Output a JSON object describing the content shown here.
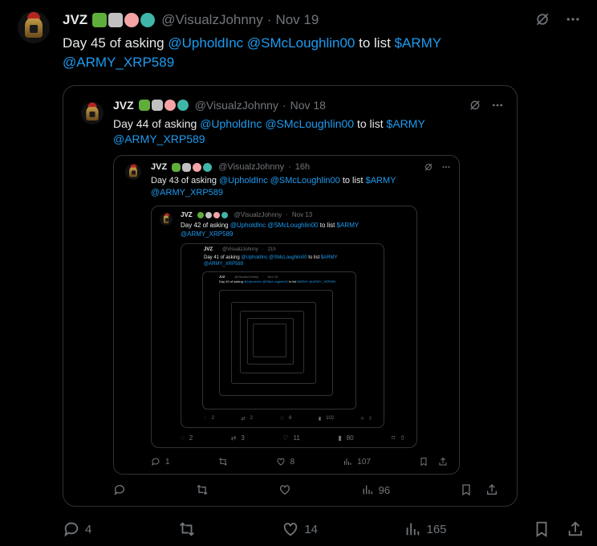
{
  "tweet": {
    "name": "JVZ",
    "handle": "@VisualzJohnny",
    "separator": "·",
    "date": "Nov 19",
    "text_prefix": "Day 45 of asking",
    "mention1": "@UpholdInc",
    "mention2": "@SMcLoughlin00",
    "text_mid": "to list",
    "cashtag": "$ARMY",
    "mention3": "@ARMY_XRP589",
    "stats": {
      "replies": "4",
      "likes": "14",
      "views": "165"
    }
  },
  "quote1": {
    "name": "JVZ",
    "handle": "@VisualzJohnny",
    "separator": "·",
    "date": "Nov 18",
    "text_prefix": "Day 44 of asking",
    "mention1": "@UpholdInc",
    "mention2": "@SMcLoughlin00",
    "text_mid": "to list",
    "cashtag": "$ARMY",
    "mention3": "@ARMY_XRP589",
    "stats": {
      "views": "96"
    }
  },
  "quote2": {
    "name": "JVZ",
    "handle": "@VisualzJohnny",
    "separator": "·",
    "date": "16h",
    "text_prefix": "Day 43 of asking",
    "mention1": "@UpholdInc",
    "mention2": "@SMcLoughlin00",
    "text_mid": "to list",
    "cashtag": "$ARMY",
    "mention3": "@ARMY_XRP589",
    "stats": {
      "replies": "1",
      "likes": "8",
      "views": "107"
    }
  },
  "quote3": {
    "name": "JVZ",
    "handle": "@VisualzJohnny",
    "separator": "·",
    "date": "Nov 13",
    "text_prefix": "Day 42 of asking",
    "mention1": "@UpholdInc",
    "mention2": "@SMcLoughlin00",
    "text_mid": "to list",
    "cashtag": "$ARMY",
    "mention3": "@ARMY_XRP589",
    "stats": {
      "replies": "2",
      "retweets": "3",
      "likes": "11",
      "views": "80"
    }
  },
  "quote4": {
    "name": "JVZ",
    "handle": "@VisualzJohnny",
    "separator": "·",
    "date": "21h",
    "text_prefix": "Day 41 of asking",
    "mention1": "@UpholdInc",
    "mention2": "@SMcLoughlin00",
    "text_mid": "to list",
    "cashtag": "$ARMY",
    "mention3": "@ARMY_XRP589",
    "stats": {
      "replies": "2",
      "retweets": "2",
      "likes": "6",
      "views": "102"
    }
  },
  "quote5": {
    "name": "JVZ",
    "handle": "@VisualzJohnny",
    "separator": "·",
    "date": "Nov 10",
    "text_prefix": "Day 40 of asking",
    "mention1": "@UpholdInc",
    "mention2": "@SMcLoughlin00",
    "text_mid": "to list",
    "cashtag": "$ARMY",
    "mention3": "@ARMY_XRP589"
  },
  "emoji_colors": [
    "#5fae3c",
    "#c0c0c0",
    "#f4a4a4",
    "#3fb6a8"
  ],
  "icons": {
    "reply": "reply-icon",
    "retweet": "retweet-icon",
    "like": "heart-icon",
    "views": "views-icon",
    "bookmark": "bookmark-icon",
    "share": "share-icon",
    "grok": "grok-icon",
    "more": "more-icon"
  },
  "colors": {
    "link": "#1d9bf0",
    "muted": "#71767b",
    "border": "#2f3336",
    "text": "#e7e9ea"
  }
}
